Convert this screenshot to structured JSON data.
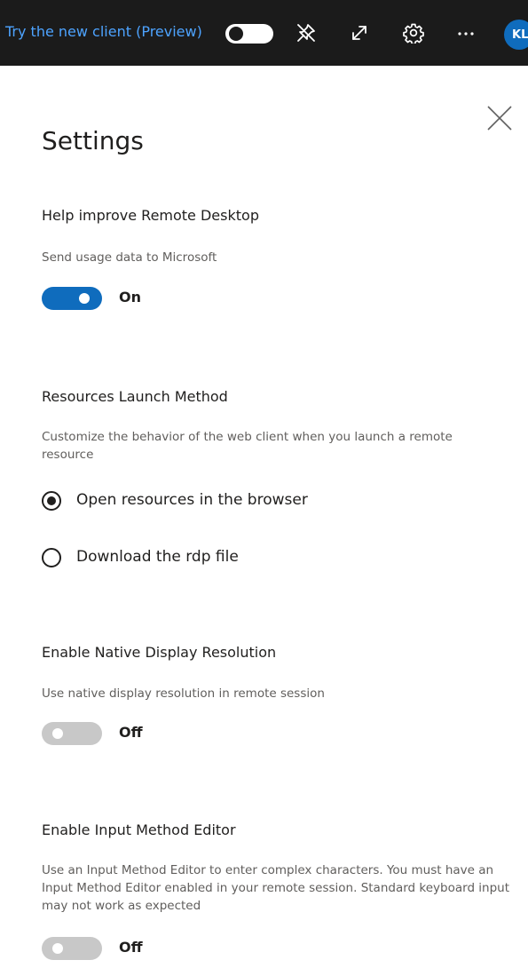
{
  "header": {
    "try_new_client": "Try the new client (Preview)",
    "icons": [
      "unpin-icon",
      "expand-icon",
      "gear-icon",
      "more-icon"
    ],
    "avatar_initials": "KL"
  },
  "settings": {
    "title": "Settings",
    "telemetry": {
      "heading": "Help improve Remote Desktop",
      "description": "Send usage data to Microsoft",
      "state": "On"
    },
    "launch": {
      "heading": "Resources Launch Method",
      "description": "Customize the behavior of the web client when you launch a remote resource",
      "options": [
        {
          "label": "Open resources in the browser",
          "selected": true
        },
        {
          "label": "Download the rdp file",
          "selected": false
        }
      ]
    },
    "native_resolution": {
      "heading": "Enable Native Display Resolution",
      "description": "Use native display resolution in remote session",
      "state": "Off"
    },
    "ime": {
      "heading": "Enable Input Method Editor",
      "description": "Use an Input Method Editor to enter complex characters. You must have an Input Method Editor enabled in your remote session. Standard keyboard input may not work as expected",
      "state": "Off"
    }
  },
  "colors": {
    "accent": "#0f6cbd",
    "link": "#4da3ff",
    "topbar": "#1b1b1b",
    "toggle_off": "#c8c8c8"
  }
}
